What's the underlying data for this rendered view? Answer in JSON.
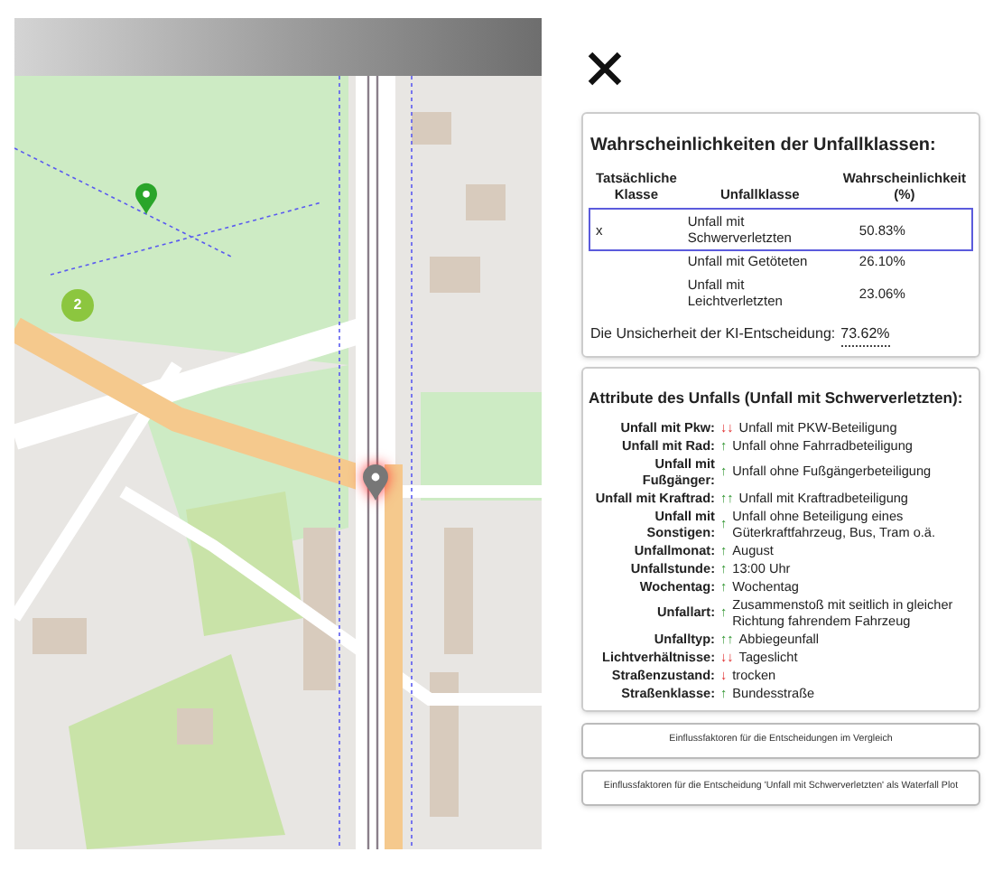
{
  "map": {
    "markers": [
      {
        "kind": "cluster",
        "label": "2"
      },
      {
        "kind": "accident"
      },
      {
        "kind": "location"
      }
    ]
  },
  "probabilities": {
    "title": "Wahrscheinlichkeiten der Unfallklassen:",
    "columns": [
      "Tatsächliche Klasse",
      "Unfallklasse",
      "Wahrscheinlichkeit (%)"
    ],
    "rows": [
      {
        "actual": "x",
        "class": "Unfall mit Schwerverletzten",
        "probability": "50.83%",
        "selected": true
      },
      {
        "class": "Unfall mit Getöteten",
        "probability": "26.10%",
        "selected": false
      },
      {
        "class": "Unfall mit Leichtverletzten",
        "probability": "23.06%",
        "selected": false
      }
    ],
    "uncertainty_label": "Die Unsicherheit der KI-Entscheidung:",
    "uncertainty_value": "73.62%"
  },
  "attributes": {
    "title": "Attribute des Unfalls (Unfall mit Schwerverletzten):",
    "rows": [
      {
        "label": "Unfall mit Pkw:",
        "arrows": "↓↓",
        "kind": "down",
        "value": "Unfall mit PKW-Beteiligung"
      },
      {
        "label": "Unfall mit Rad:",
        "arrows": "↑",
        "kind": "up",
        "value": "Unfall ohne Fahrradbeteiligung"
      },
      {
        "label": "Unfall mit Fußgänger:",
        "arrows": "↑",
        "kind": "up",
        "value": "Unfall ohne Fußgängerbeteiligung"
      },
      {
        "label": "Unfall mit Kraftrad:",
        "arrows": "↑↑",
        "kind": "up",
        "value": "Unfall mit Kraftradbeteiligung"
      },
      {
        "label": "Unfall mit Sonstigen:",
        "arrows": "↑",
        "kind": "up",
        "value": "Unfall ohne Beteiligung eines Güterkraftfahrzeug, Bus, Tram o.ä."
      },
      {
        "label": "Unfallmonat:",
        "arrows": "↑",
        "kind": "up",
        "value": "August"
      },
      {
        "label": "Unfallstunde:",
        "arrows": "↑",
        "kind": "up",
        "value": "13:00 Uhr"
      },
      {
        "label": "Wochentag:",
        "arrows": "↑",
        "kind": "up",
        "value": "Wochentag"
      },
      {
        "label": "Unfallart:",
        "arrows": "↑",
        "kind": "up",
        "value": "Zusammenstoß mit seitlich in gleicher Richtung fahrendem Fahrzeug"
      },
      {
        "label": "Unfalltyp:",
        "arrows": "↑↑",
        "kind": "up",
        "value": "Abbiegeunfall"
      },
      {
        "label": "Lichtverhältnisse:",
        "arrows": "↓↓",
        "kind": "down",
        "value": "Tageslicht"
      },
      {
        "label": "Straßenzustand:",
        "arrows": "↓",
        "kind": "down",
        "value": "trocken"
      },
      {
        "label": "Straßenklasse:",
        "arrows": "↑",
        "kind": "up",
        "value": "Bundesstraße"
      }
    ]
  },
  "buttons": [
    "Einflussfaktoren für die Entscheidungen im Vergleich",
    "Einflussfaktoren für die Entscheidung 'Unfall mit Schwerverletzten' als Waterfall Plot"
  ]
}
